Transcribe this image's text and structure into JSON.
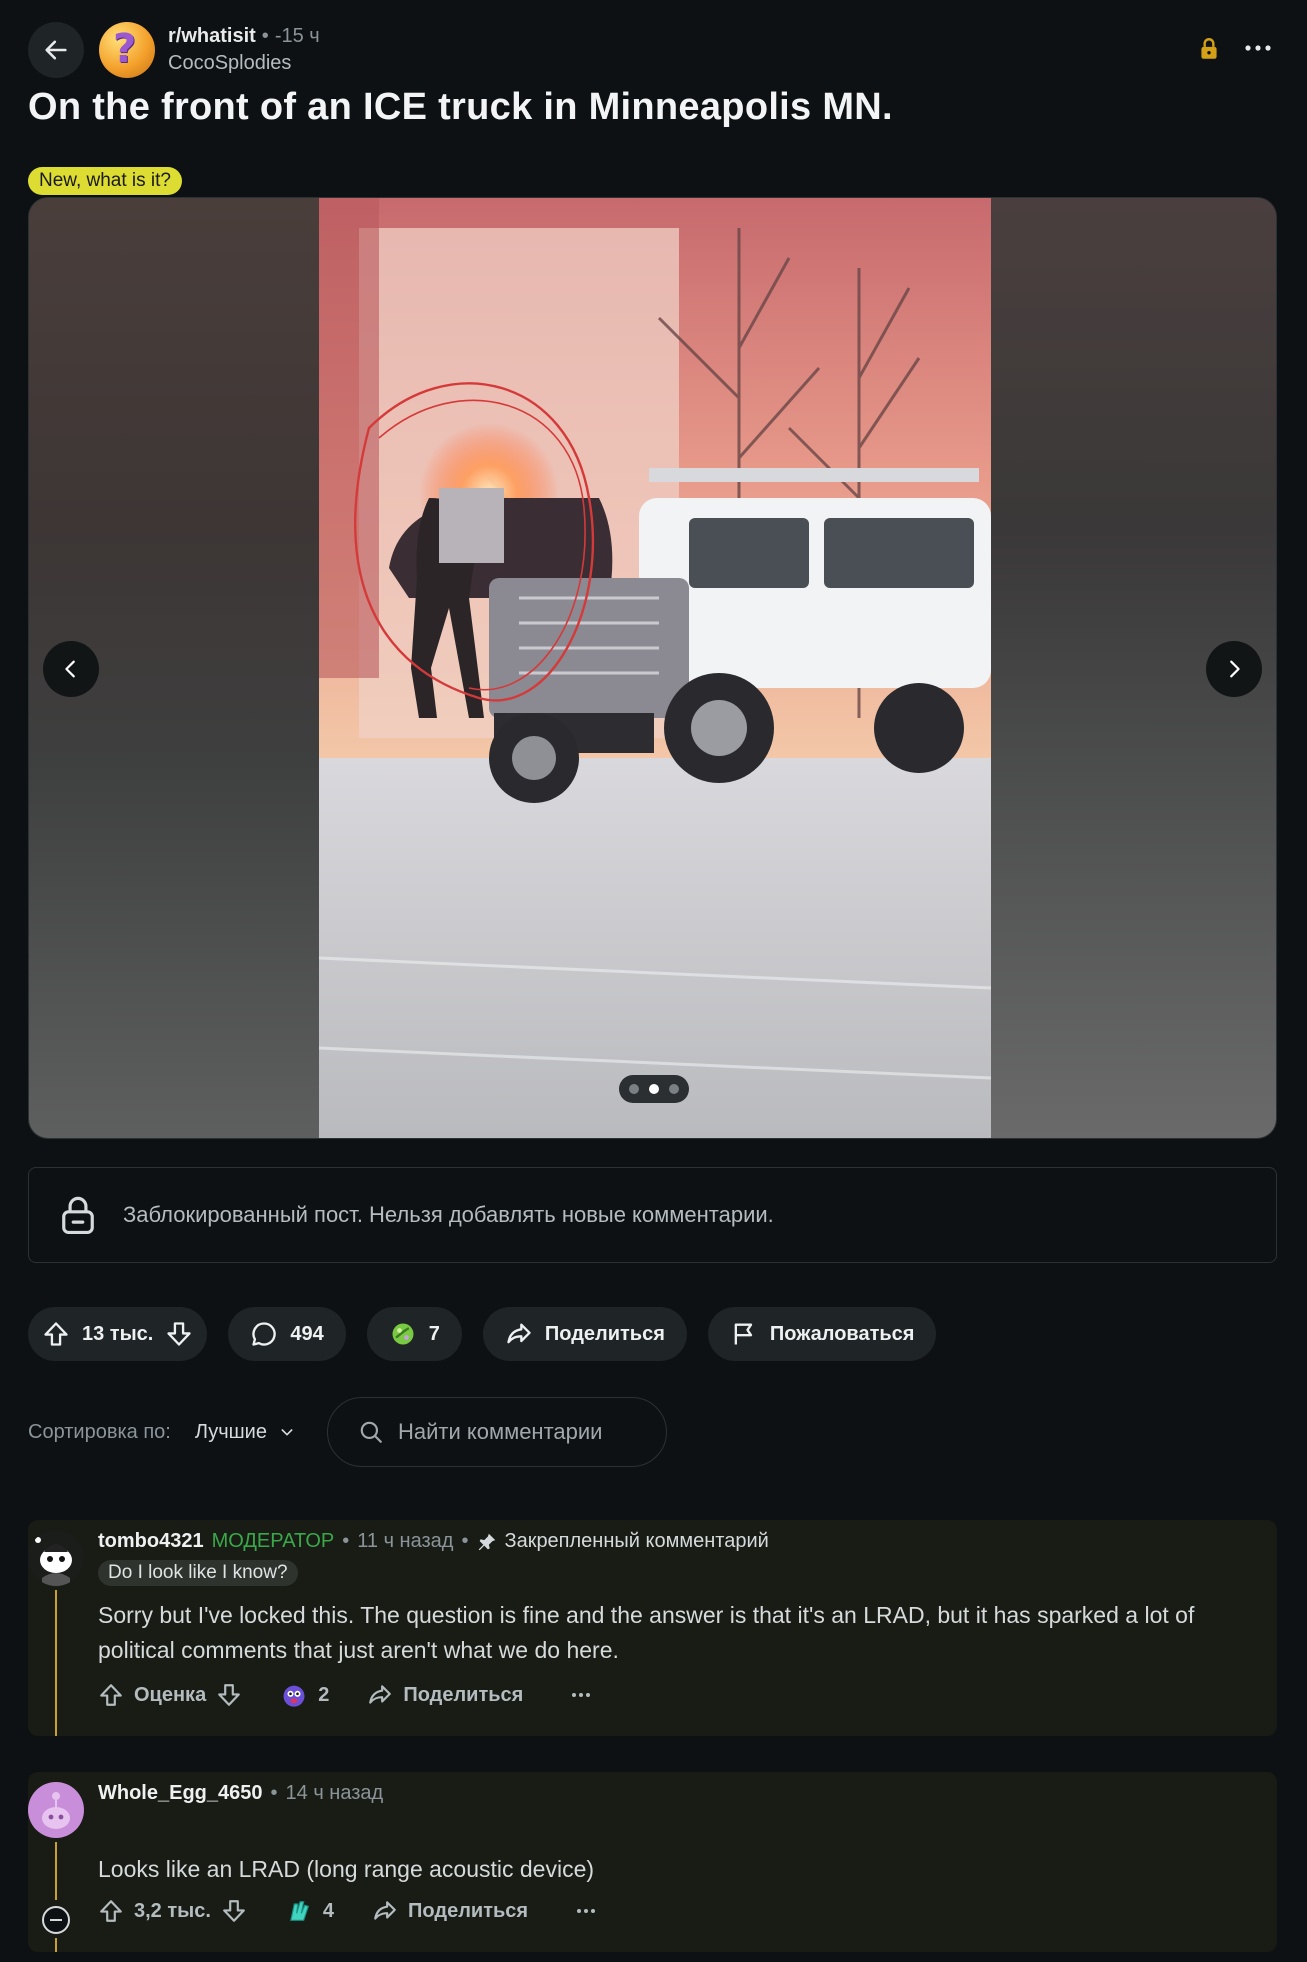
{
  "post": {
    "subreddit": "r/whatisit",
    "time": "-15 ч",
    "author": "CocoSplodies",
    "title": "On the front of an ICE truck in Minneapolis MN.",
    "flair": "New, what is it?"
  },
  "locked_banner": "Заблокированный пост. Нельзя добавлять новые комментарии.",
  "actions": {
    "votes": "13 тыс.",
    "comments": "494",
    "awards": "7",
    "share": "Поделиться",
    "report": "Пожаловаться"
  },
  "sort": {
    "label": "Сортировка по:",
    "value": "Лучшие",
    "search_placeholder": "Найти комментарии"
  },
  "carousel": {
    "slides": 3,
    "active": 2
  },
  "comments": [
    {
      "author": "tombo4321",
      "role": "МОДЕРАТОР",
      "time": "11 ч назад",
      "pinned": "Закрепленный комментарий",
      "user_flair": "Do I look like I know?",
      "body": "Sorry but I've locked this. The question is fine and the answer is that it's an LRAD, but it has sparked a lot of political comments that just aren't what we do here.",
      "vote_label": "Оценка",
      "awards": "2",
      "share": "Поделиться"
    },
    {
      "author": "Whole_Egg_4650",
      "time": "14 ч назад",
      "body": "Looks like an LRAD (long range acoustic device)",
      "vote_label": "3,2 тыс.",
      "awards": "4",
      "share": "Поделиться"
    }
  ],
  "colors": {
    "background": "#0e1113",
    "flair": "#dcdc32",
    "moderator": "#3aa84a",
    "thread_line": "#c9a227",
    "lock": "#d4a017"
  }
}
